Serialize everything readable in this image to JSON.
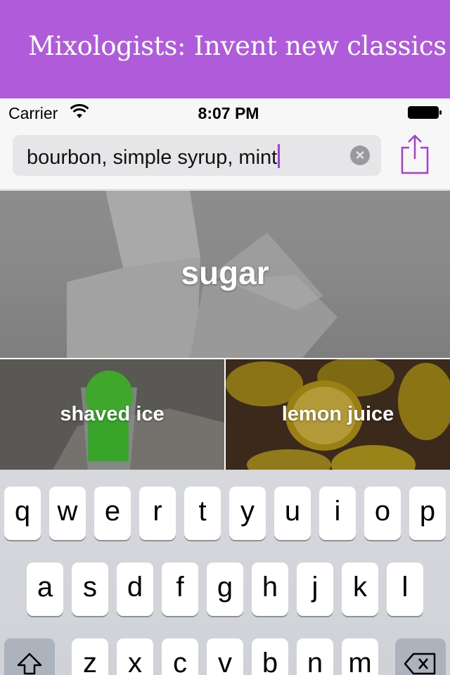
{
  "banner": {
    "title": "Mixologists: Invent new classics"
  },
  "status_bar": {
    "carrier": "Carrier",
    "time": "8:07 PM"
  },
  "search": {
    "value": "bourbon, simple syrup, mint"
  },
  "ingredients": [
    {
      "label": "sugar"
    },
    {
      "label": "shaved ice"
    },
    {
      "label": "lemon juice"
    }
  ],
  "keyboard": {
    "row1": [
      "q",
      "w",
      "e",
      "r",
      "t",
      "y",
      "u",
      "i",
      "o",
      "p"
    ],
    "row2": [
      "a",
      "s",
      "d",
      "f",
      "g",
      "h",
      "j",
      "k",
      "l"
    ],
    "row3": [
      "z",
      "x",
      "c",
      "v",
      "b",
      "n",
      "m"
    ],
    "shift_icon": "shift-icon",
    "delete_icon": "backspace-icon"
  },
  "colors": {
    "banner": "#b05bd9",
    "accent": "#a43fd6"
  }
}
